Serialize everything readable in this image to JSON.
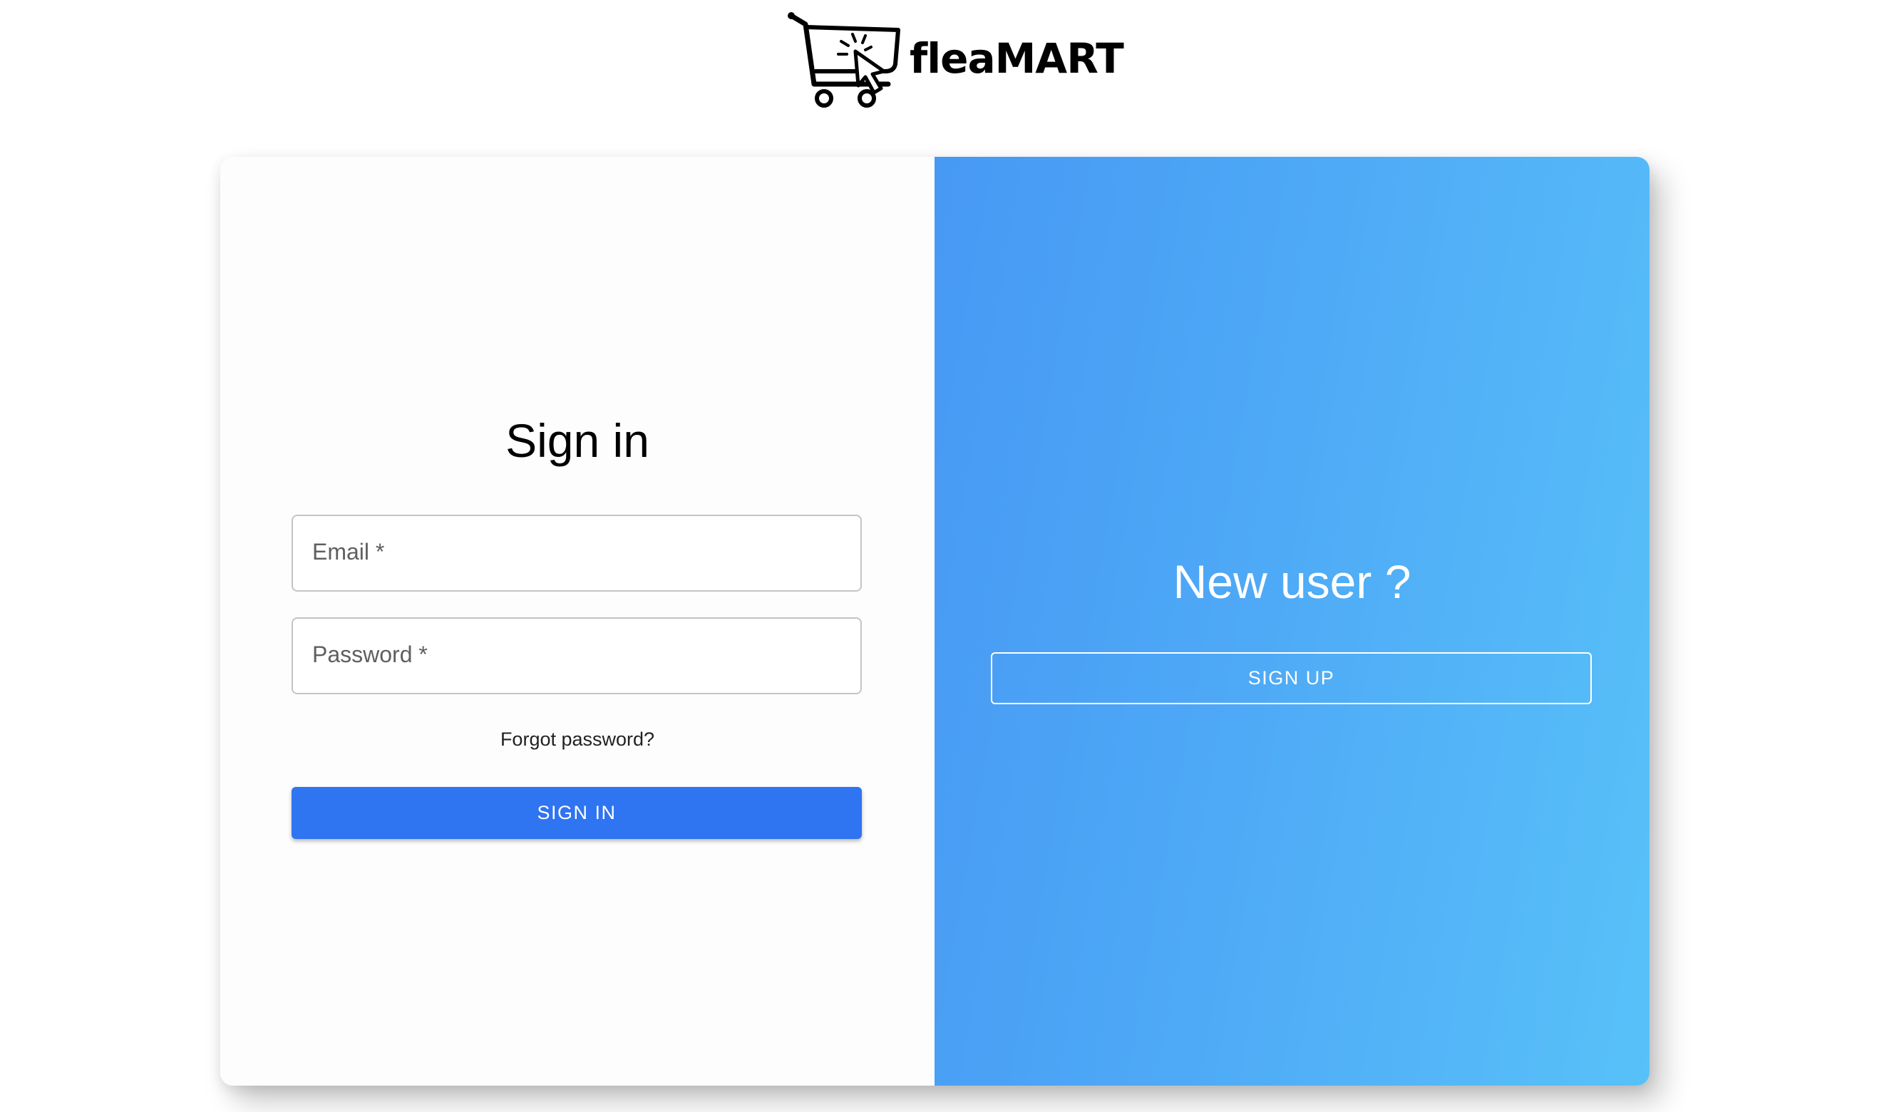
{
  "brand": {
    "name": "fleaMART",
    "logo_icon": "shopping-cart-cursor-icon"
  },
  "signin": {
    "title": "Sign in",
    "email_label": "Email *",
    "password_label": "Password *",
    "forgot_password": "Forgot password?",
    "submit_label": "SIGN IN"
  },
  "signup": {
    "title": "New user ?",
    "button_label": "SIGN UP"
  },
  "colors": {
    "primary_button": "#2f74f0",
    "gradient_start": "#4799f4",
    "gradient_end": "#58c1f9"
  }
}
